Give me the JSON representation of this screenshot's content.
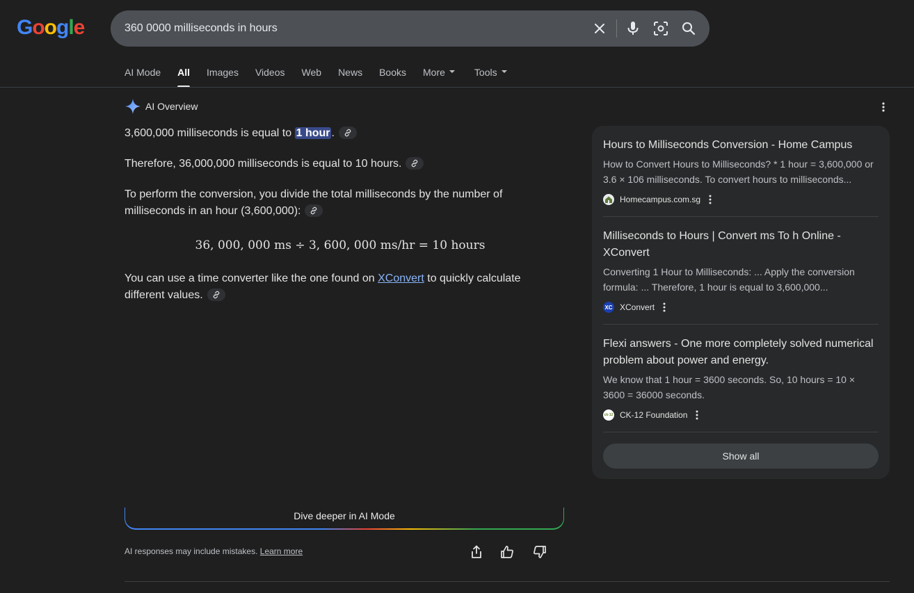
{
  "logo": {
    "text": "Google"
  },
  "search": {
    "query": "360 0000 milliseconds in hours"
  },
  "tabs": [
    {
      "label": "AI Mode"
    },
    {
      "label": "All"
    },
    {
      "label": "Images"
    },
    {
      "label": "Videos"
    },
    {
      "label": "Web"
    },
    {
      "label": "News"
    },
    {
      "label": "Books"
    },
    {
      "label": "More"
    },
    {
      "label": "Tools"
    }
  ],
  "ai_overview": {
    "title": "AI Overview",
    "p1_text": "3,600,000 milliseconds is equal to ",
    "p1_highlight": "1 hour",
    "p1_end": ".",
    "p2": "Therefore, 36,000,000 milliseconds is equal to 10 hours.",
    "p3": "To perform the conversion, you divide the total milliseconds by the number of milliseconds in an hour (3,600,000):",
    "formula": "36, 000, 000 ms ÷ 3, 600, 000 ms/hr = 10 hours",
    "p4_before": "You can use a time converter like the one found on ",
    "p4_link": "XConvert",
    "p4_after": " to quickly calculate different values.",
    "dive_label": "Dive deeper in AI Mode",
    "disclaimer": "AI responses may include mistakes.",
    "learn_more": "Learn more"
  },
  "sources": [
    {
      "title": "Hours to Milliseconds Conversion - Home Campus",
      "snippet": "How to Convert Hours to Milliseconds? * 1 hour = 3,600,000 or 3.6 × 106 milliseconds. To convert hours to milliseconds...",
      "site": "Homecampus.com.sg"
    },
    {
      "title": "Milliseconds to Hours | Convert ms To h Online - XConvert",
      "snippet": "Converting 1 Hour to Milliseconds: ... Apply the conversion formula: ... Therefore, 1 hour is equal to 3,600,000...",
      "site": "XConvert",
      "favicon_text": "XC"
    },
    {
      "title": "Flexi answers - One more completely solved numerical problem about power and energy.",
      "snippet": "We know that 1 hour = 3600 seconds. So, 10 hours = 10 × 3600 = 36000 seconds.",
      "site": "CK-12 Foundation",
      "favicon_text": "ck-12"
    }
  ],
  "show_all": "Show all",
  "colors": {
    "background": "#1f1f1f",
    "search_bar": "#4d5156",
    "highlight": "#394a8a",
    "link": "#8ab4f8",
    "sources_panel": "#28292a",
    "google_blue": "#4285f4",
    "google_red": "#ea4335",
    "google_yellow": "#fbbc05",
    "google_green": "#34a853"
  }
}
